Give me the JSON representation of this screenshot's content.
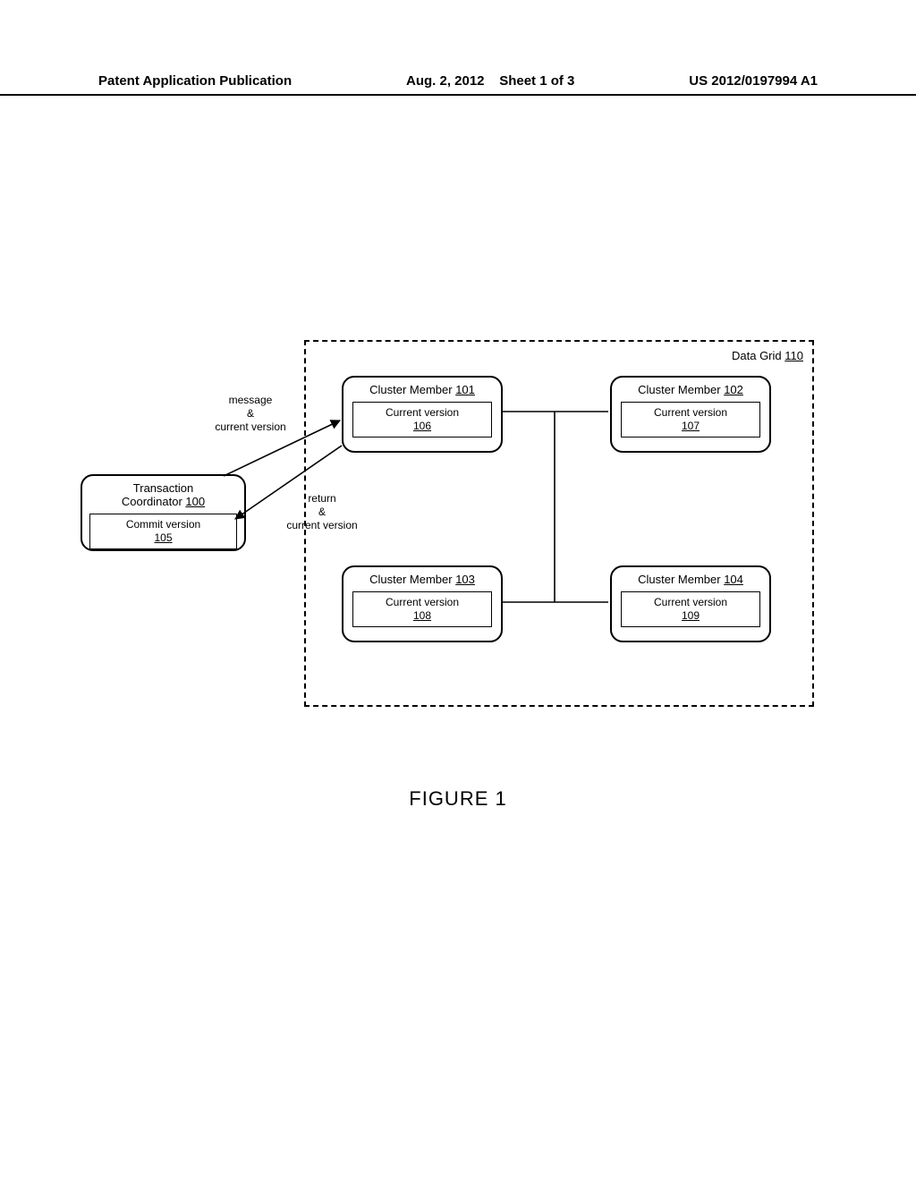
{
  "header": {
    "left": "Patent Application Publication",
    "date": "Aug. 2, 2012",
    "sheet": "Sheet 1 of 3",
    "pubno": "US 2012/0197994 A1"
  },
  "figure_caption": "FIGURE 1",
  "datagrid": {
    "label_text": "Data Grid",
    "label_ref": "110"
  },
  "tc": {
    "title_text": "Transaction Coordinator",
    "title_ref": "100",
    "inner_text": "Commit version",
    "inner_ref": "105"
  },
  "edges": {
    "msg_line1": "message",
    "msg_line2": "&",
    "msg_line3": "current version",
    "ret_line1": "return",
    "ret_line2": "&",
    "ret_line3": "current version"
  },
  "cluster_members": {
    "cm101": {
      "title_text": "Cluster Member",
      "title_ref": "101",
      "inner_text": "Current version",
      "inner_ref": "106"
    },
    "cm102": {
      "title_text": "Cluster Member",
      "title_ref": "102",
      "inner_text": "Current version",
      "inner_ref": "107"
    },
    "cm103": {
      "title_text": "Cluster Member",
      "title_ref": "103",
      "inner_text": "Current version",
      "inner_ref": "108"
    },
    "cm104": {
      "title_text": "Cluster Member",
      "title_ref": "104",
      "inner_text": "Current version",
      "inner_ref": "109"
    }
  }
}
